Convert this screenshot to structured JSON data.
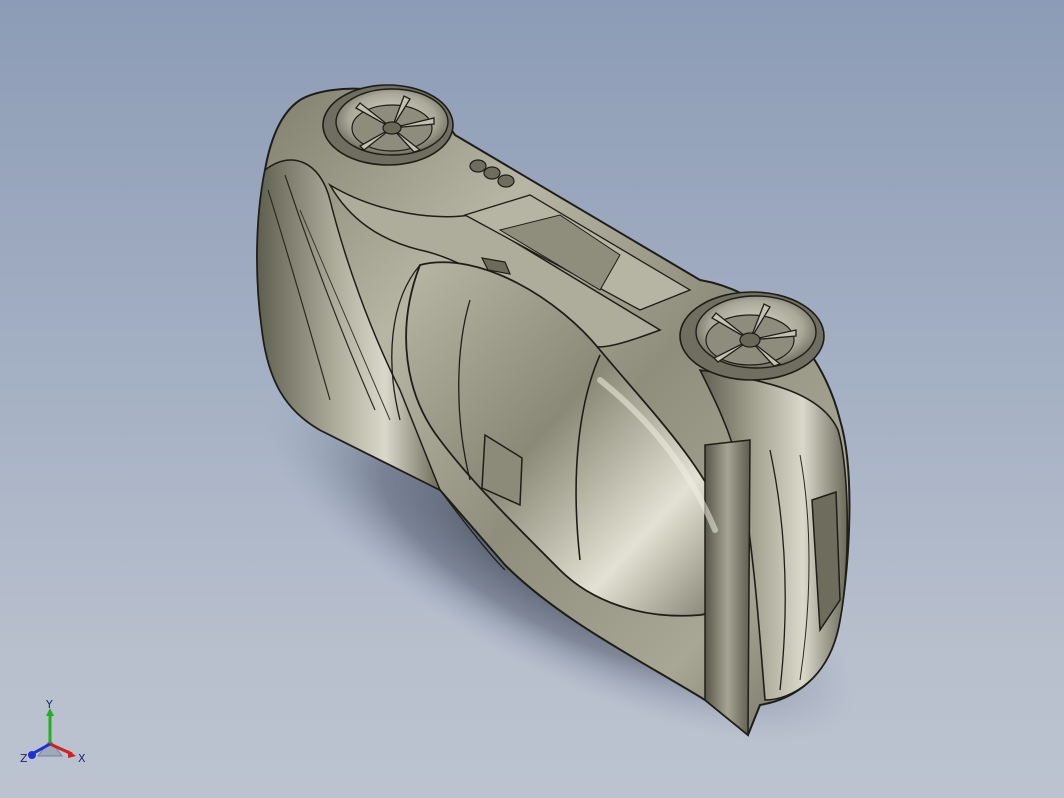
{
  "viewport": {
    "background_top": "#8d9cb6",
    "background_bottom": "#bcc3d0"
  },
  "model": {
    "body_color": "#9a9986",
    "body_highlight": "#e6e5d8",
    "body_shadow": "#4a4a40",
    "edge_color": "#1e1e18",
    "wheel_color": "#c9c8bb"
  },
  "triad": {
    "y_label": "Y",
    "x_label": "X",
    "z_label": "Z",
    "x_color": "#d22020",
    "y_color": "#20b020",
    "z_color": "#2030d0"
  }
}
